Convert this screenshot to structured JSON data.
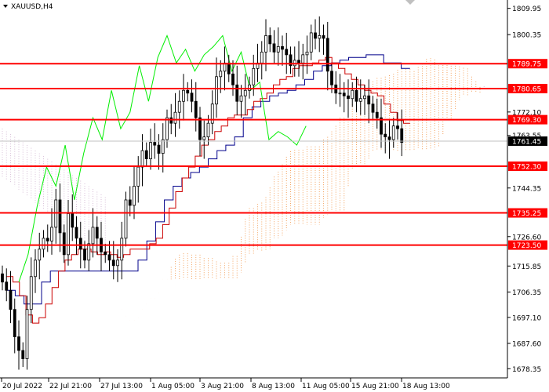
{
  "window": {
    "symbol_title": "XAUUSD,H4"
  },
  "colors": {
    "bull_body": "#ffffff",
    "bear_body": "#000000",
    "wick": "#000000",
    "tenkan": "#cc0000",
    "kijun": "#00008b",
    "chikou": "#00ee00",
    "kumo_bull": "#f4a460",
    "kumo_bear": "#d8bfd8",
    "level_line": "#ff0000",
    "label_bg": "#ff0000",
    "label_text": "#ffffff",
    "price_label_bg": "#000000",
    "price_line": "#c0c0c0"
  },
  "chart_data": {
    "type": "candlestick",
    "title": "XAUUSD,H4",
    "ylim": [
      1675,
      1813
    ],
    "grid": false,
    "x_tick_labels": [
      "20 Jul 2022",
      "22 Jul 21:00",
      "27 Jul 13:00",
      "1 Aug 05:00",
      "3 Aug 21:00",
      "8 Aug 13:00",
      "11 Aug 05:00",
      "15 Aug 21:00",
      "18 Aug 13:00"
    ],
    "y_tick_labels": [
      "1809.95",
      "1800.35",
      "1789.75",
      "1780.65",
      "1772.10",
      "1769.30",
      "1763.55",
      "1761.45",
      "1752.30",
      "1744.35",
      "1735.25",
      "1726.60",
      "1723.50",
      "1715.85",
      "1706.35",
      "1697.10",
      "1687.60",
      "1678.35"
    ],
    "horizontal_levels": [
      1789.75,
      1780.65,
      1769.3,
      1752.3,
      1735.25,
      1723.5
    ],
    "current_price": 1761.45,
    "candles_close": [
      1710,
      1707,
      1700,
      1690,
      1685,
      1682,
      1700,
      1712,
      1718,
      1722,
      1726,
      1725,
      1730,
      1740,
      1728,
      1720,
      1735,
      1730,
      1726,
      1722,
      1718,
      1724,
      1730,
      1726,
      1721,
      1720,
      1718,
      1716,
      1718,
      1726,
      1740,
      1738,
      1745,
      1752,
      1758,
      1755,
      1761,
      1760,
      1757,
      1762,
      1770,
      1768,
      1772,
      1776,
      1780,
      1779,
      1776,
      1770,
      1762,
      1763,
      1768,
      1775,
      1785,
      1787,
      1790,
      1786,
      1782,
      1776,
      1778,
      1780,
      1782,
      1788,
      1790,
      1794,
      1800,
      1797,
      1794,
      1796,
      1795,
      1793,
      1789,
      1791,
      1790,
      1793,
      1794,
      1801,
      1799,
      1800,
      1799,
      1787,
      1782,
      1779,
      1779,
      1778,
      1777,
      1780,
      1776,
      1777,
      1778,
      1775,
      1772,
      1770,
      1764,
      1763,
      1762,
      1767,
      1766,
      1761
    ],
    "ichimoku": {
      "tenkan": [
        1712,
        1710,
        1705,
        1698,
        1695,
        1697,
        1702,
        1708,
        1714,
        1718,
        1720,
        1722,
        1722,
        1721,
        1720,
        1721,
        1720,
        1719,
        1720,
        1722,
        1722,
        1722,
        1724,
        1726,
        1731,
        1737,
        1743,
        1748,
        1752,
        1756,
        1760,
        1762,
        1765,
        1767,
        1770,
        1771,
        1771,
        1773,
        1776,
        1777,
        1779,
        1782,
        1784,
        1785,
        1788,
        1789,
        1789,
        1790,
        1791,
        1792,
        1790,
        1788,
        1786,
        1784,
        1782,
        1780,
        1779,
        1778,
        1775,
        1772,
        1769,
        1768
      ],
      "kijun": [
        1707,
        1705,
        1702,
        1702,
        1710,
        1714,
        1714,
        1714,
        1714,
        1714,
        1714,
        1714,
        1714,
        1714,
        1714,
        1718,
        1725,
        1732,
        1740,
        1745,
        1748,
        1750,
        1752,
        1755,
        1758,
        1760,
        1763,
        1770,
        1774,
        1776,
        1778,
        1779,
        1780,
        1782,
        1784,
        1787,
        1789,
        1790,
        1791,
        1792,
        1792,
        1793,
        1793,
        1790,
        1790,
        1788
      ],
      "chikou": [
        1710,
        1720,
        1738,
        1752,
        1745,
        1760,
        1740,
        1757,
        1770,
        1762,
        1780,
        1766,
        1772,
        1789,
        1776,
        1792,
        1800,
        1790,
        1795,
        1787,
        1793,
        1796,
        1800,
        1787,
        1794,
        1780,
        1783,
        1762,
        1765,
        1763,
        1760,
        1767
      ]
    }
  }
}
